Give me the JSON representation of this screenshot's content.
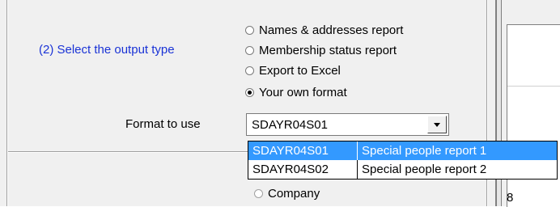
{
  "section": {
    "label": "(2) Select the output type"
  },
  "output_types": [
    {
      "label": "Names & addresses report",
      "checked": false
    },
    {
      "label": "Membership status report",
      "checked": false
    },
    {
      "label": "Export to Excel",
      "checked": false
    },
    {
      "label": "Your own format",
      "checked": true
    }
  ],
  "format": {
    "label": "Format to use",
    "selected_value": "SDAYR04S01",
    "options": [
      {
        "code": "SDAYR04S01",
        "description": "Special people report 1",
        "highlighted": true
      },
      {
        "code": "SDAYR04S02",
        "description": "Special people report 2",
        "highlighted": false
      }
    ]
  },
  "partial": {
    "company_label": "Company",
    "right_number": "8"
  },
  "colors": {
    "section_label": "#1a33d6",
    "highlight": "#3399ff",
    "panel_bg": "#f0f0f0"
  }
}
